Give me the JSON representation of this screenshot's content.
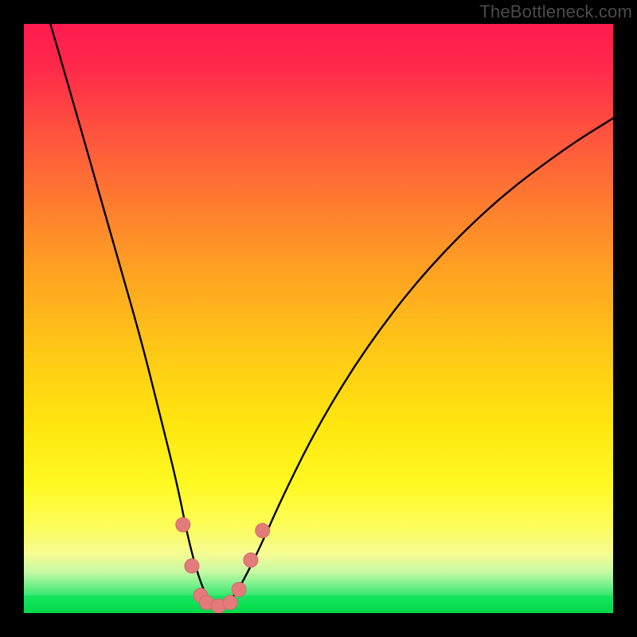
{
  "watermark": "TheBottleneck.com",
  "colors": {
    "page_bg": "#000000",
    "curve": "#000000",
    "marker": "#e37b7b",
    "marker_edge": "#d36a6a"
  },
  "chart_data": {
    "type": "line",
    "title": "",
    "xlabel": "",
    "ylabel": "",
    "xlim": [
      0,
      100
    ],
    "ylim": [
      0,
      100
    ],
    "grid": false,
    "legend": false,
    "series": [
      {
        "name": "bottleneck-curve",
        "x": [
          4.5,
          8,
          12,
          16,
          20,
          23,
          26,
          28,
          30,
          31.5,
          33,
          35,
          37,
          40,
          44,
          50,
          58,
          68,
          80,
          92,
          100
        ],
        "values": [
          100,
          88,
          74,
          60,
          46,
          34,
          22,
          12,
          5,
          2,
          1.2,
          2,
          5,
          11,
          20,
          32,
          45,
          58,
          70,
          79,
          84
        ]
      }
    ],
    "markers": [
      {
        "x": 27.0,
        "y": 15.0
      },
      {
        "x": 28.5,
        "y": 8.0
      },
      {
        "x": 30.0,
        "y": 3.0
      },
      {
        "x": 31.0,
        "y": 1.8
      },
      {
        "x": 33.0,
        "y": 1.2
      },
      {
        "x": 35.0,
        "y": 1.8
      },
      {
        "x": 36.5,
        "y": 4.0
      },
      {
        "x": 38.5,
        "y": 9.0
      },
      {
        "x": 40.5,
        "y": 14.0
      }
    ],
    "gradient_stops": [
      {
        "pct": 0,
        "color": "#ff1a4f"
      },
      {
        "pct": 18,
        "color": "#ff513f"
      },
      {
        "pct": 42,
        "color": "#ffa222"
      },
      {
        "pct": 68,
        "color": "#ffe60f"
      },
      {
        "pct": 88,
        "color": "#fdfd58"
      },
      {
        "pct": 95,
        "color": "#7ef28f"
      },
      {
        "pct": 100,
        "color": "#00de4e"
      }
    ]
  }
}
